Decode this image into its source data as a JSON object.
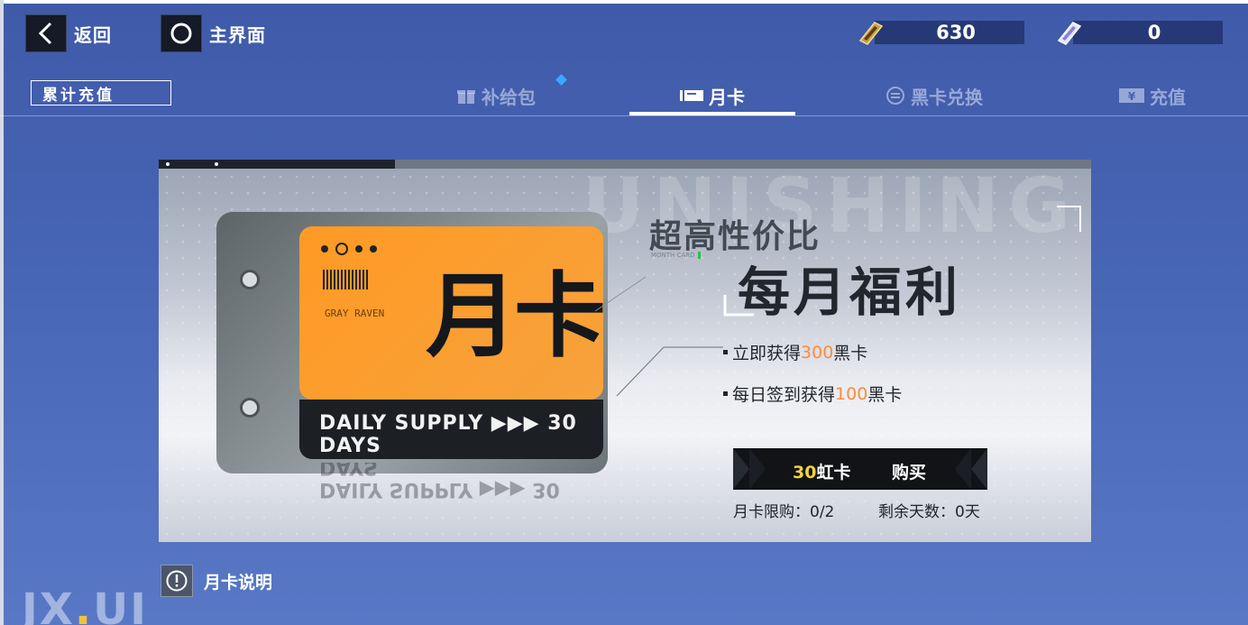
{
  "header": {
    "back_label": "返回",
    "home_label": "主界面",
    "currencies": [
      {
        "icon": "gold-ticket-icon",
        "value": "630"
      },
      {
        "icon": "crystal-card-icon",
        "value": "0"
      }
    ]
  },
  "cumulative_button": "累计充值",
  "tabs": [
    {
      "label": "补给包",
      "icon": "gift-icon",
      "active": false,
      "has_notification": true
    },
    {
      "label": "月卡",
      "icon": "card-icon",
      "active": true
    },
    {
      "label": "黑卡兑换",
      "icon": "exchange-icon",
      "active": false
    },
    {
      "label": "充值",
      "icon": "recharge-icon",
      "active": false
    }
  ],
  "banner": {
    "card_big_text": "月卡",
    "card_label": "GRAY RAVEN",
    "card_supply": "DAILY SUPPLY ▶▶▶ 30 DAYS",
    "headline_small": "超高性价比",
    "headline_sub": "MONTH CARD",
    "headline_big": "每月福利",
    "bullets": [
      {
        "prefix": "立即获得",
        "highlight": "300",
        "suffix": "黑卡"
      },
      {
        "prefix": "每日签到获得",
        "highlight": "100",
        "suffix": "黑卡"
      }
    ],
    "purchase": {
      "price_number": "30",
      "price_unit": "虹卡",
      "buy_label": "购买"
    },
    "limit_text": "月卡限购：0/2",
    "remaining_text": "剩余天数：0天"
  },
  "help_label": "月卡说明",
  "watermark": {
    "part1": "JX",
    "part2": ".",
    "part3": "UI"
  },
  "colors": {
    "highlight_orange": "#ff8a3c",
    "price_yellow": "#f3d23a",
    "card_orange": "#ff9a24",
    "notification_blue": "#39a8ff"
  }
}
